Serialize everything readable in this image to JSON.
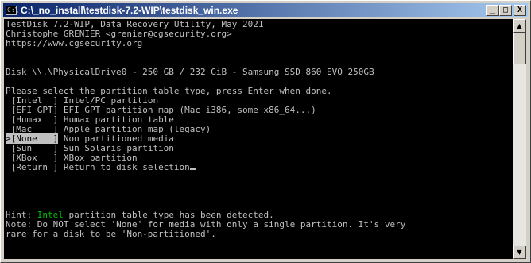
{
  "window": {
    "title": "C:\\_no_install\\testdisk-7.2-WIP\\testdisk_win.exe",
    "icon_text": "C:\\",
    "minimize_glyph": "_",
    "maximize_glyph": "□",
    "close_glyph": "X"
  },
  "console": {
    "header": [
      "TestDisk 7.2-WIP, Data Recovery Utility, May 2021",
      "Christophe GRENIER <grenier@cgsecurity.org>",
      "https://www.cgsecurity.org"
    ],
    "disk": "Disk \\\\.\\PhysicalDrive0 - 250 GB / 232 GiB - Samsung SSD 860 EVO 250GB",
    "prompt": "Please select the partition table type, press Enter when done.",
    "options": [
      {
        "key": " [Intel  ]",
        "desc": " Intel/PC partition"
      },
      {
        "key": " [EFI GPT]",
        "desc": " EFI GPT partition map (Mac i386, some x86_64...)"
      },
      {
        "key": " [Humax  ]",
        "desc": " Humax partition table"
      },
      {
        "key": " [Mac    ]",
        "desc": " Apple partition map (legacy)"
      },
      {
        "key": ">[None   ]",
        "desc": " Non partitioned media"
      },
      {
        "key": " [Sun    ]",
        "desc": " Sun Solaris partition"
      },
      {
        "key": " [XBox   ]",
        "desc": " XBox partition"
      },
      {
        "key": " [Return ]",
        "desc": " Return to disk selection"
      }
    ],
    "selected_index": 4,
    "hint_prefix": "Hint: ",
    "hint_highlight": "Intel",
    "hint_suffix": " partition table type has been detected.",
    "note_lines": [
      "Note: Do NOT select 'None' for media with only a single partition. It's very",
      "rare for a disk to be 'Non-partitioned'."
    ]
  },
  "scrollbar": {
    "up_glyph": "▲",
    "down_glyph": "▼"
  }
}
